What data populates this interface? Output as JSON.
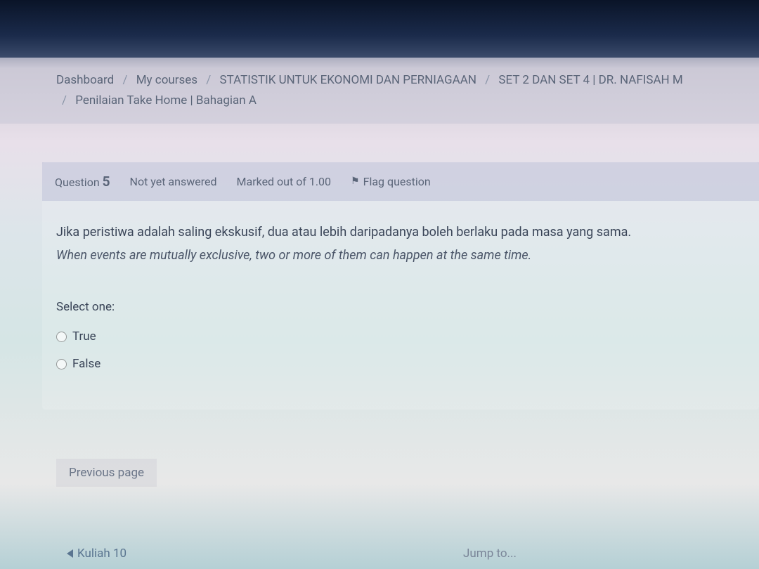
{
  "breadcrumb": {
    "items": [
      "Dashboard",
      "My courses",
      "STATISTIK UNTUK EKONOMI DAN PERNIAGAAN",
      "SET 2 DAN SET 4 | DR. NAFISAH M",
      "Penilaian Take Home | Bahagian A"
    ],
    "separator": "/"
  },
  "question": {
    "label": "Question",
    "number": "5",
    "status": "Not yet answered",
    "marks": "Marked out of 1.00",
    "flag_label": "Flag question",
    "text_ms": "Jika peristiwa adalah saling ekskusif, dua atau lebih daripadanya boleh berlaku pada masa yang sama.",
    "text_en": "When events are mutually exclusive, two or more of them can happen at the same time.",
    "select_label": "Select one:",
    "options": {
      "true_label": "True",
      "false_label": "False"
    }
  },
  "nav": {
    "prev_page": "Previous page",
    "prev_activity": "Kuliah 10",
    "jump_to": "Jump to..."
  }
}
